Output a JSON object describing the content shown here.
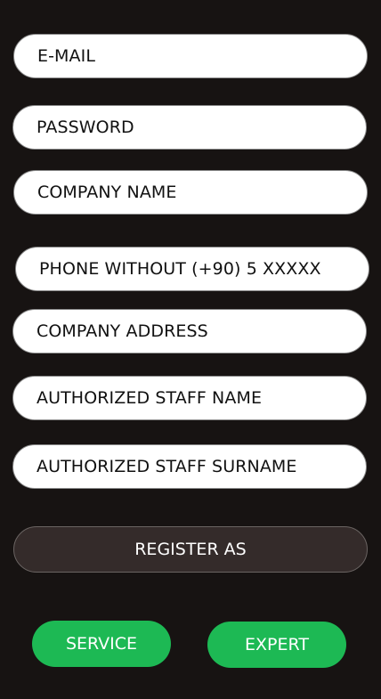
{
  "form": {
    "email_placeholder": "E-MAIL",
    "password_placeholder": "PASSWORD",
    "company_name_placeholder": "COMPANY NAME",
    "phone_placeholder": "PHONE WITHOUT (+90) 5 XXXXX",
    "company_address_placeholder": "COMPANY ADDRESS",
    "staff_name_placeholder": "AUTHORIZED STAFF NAME",
    "staff_surname_placeholder": "AUTHORIZED STAFF SURNAME"
  },
  "register": {
    "label": "REGISTER AS"
  },
  "roles": {
    "service_label": "SERVICE",
    "expert_label": "EXPERT"
  },
  "colors": {
    "background": "#171312",
    "field_background": "#ffffff",
    "register_background": "#342b2a",
    "accent_green": "#1db954"
  }
}
